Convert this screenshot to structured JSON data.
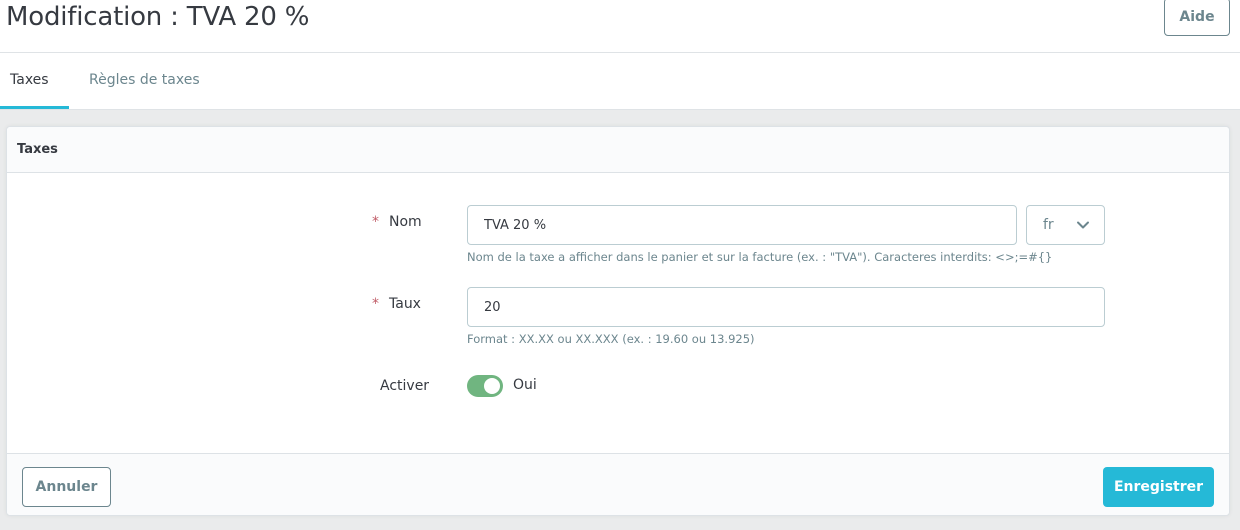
{
  "header": {
    "title": "Modification : TVA 20 %",
    "help_label": "Aide"
  },
  "tabs": [
    {
      "label": "Taxes",
      "active": true
    },
    {
      "label": "Règles de taxes",
      "active": false
    }
  ],
  "card": {
    "title": "Taxes",
    "fields": {
      "name": {
        "required_mark": "*",
        "label": "Nom",
        "value": "TVA 20 %",
        "language": "fr",
        "help": "Nom de la taxe a afficher dans le panier et sur la facture (ex. : \"TVA\"). Caracteres interdits: <>;=#{}"
      },
      "rate": {
        "required_mark": "*",
        "label": "Taux",
        "value": "20",
        "help": "Format : XX.XX ou XX.XXX (ex. : 19.60 ou 13.925)"
      },
      "enabled": {
        "label": "Activer",
        "state_label": "Oui",
        "on": true
      }
    },
    "footer": {
      "cancel_label": "Annuler",
      "save_label": "Enregistrer"
    }
  },
  "colors": {
    "accent": "#25b9d7",
    "toggle_on": "#70b580",
    "required": "#c05c67"
  },
  "icons": {
    "language_dropdown": "chevron-down-icon"
  }
}
